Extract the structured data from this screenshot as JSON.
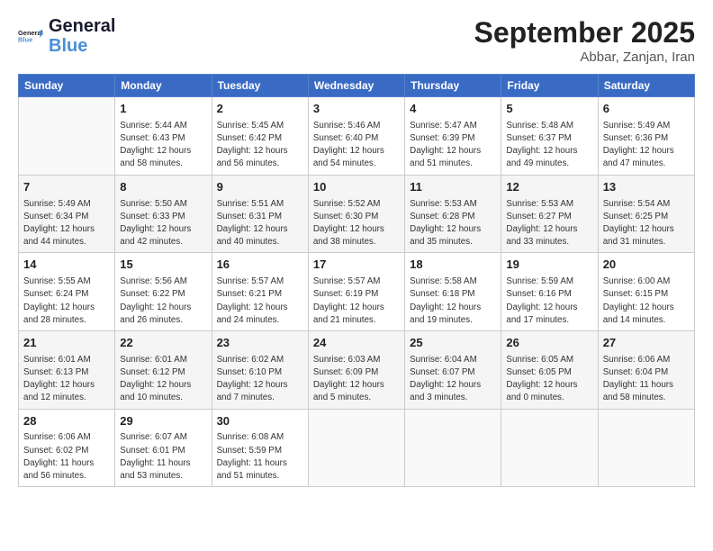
{
  "header": {
    "logo_line1": "General",
    "logo_line2": "Blue",
    "month": "September 2025",
    "location": "Abbar, Zanjan, Iran"
  },
  "weekdays": [
    "Sunday",
    "Monday",
    "Tuesday",
    "Wednesday",
    "Thursday",
    "Friday",
    "Saturday"
  ],
  "weeks": [
    [
      {
        "day": "",
        "info": ""
      },
      {
        "day": "1",
        "info": "Sunrise: 5:44 AM\nSunset: 6:43 PM\nDaylight: 12 hours\nand 58 minutes."
      },
      {
        "day": "2",
        "info": "Sunrise: 5:45 AM\nSunset: 6:42 PM\nDaylight: 12 hours\nand 56 minutes."
      },
      {
        "day": "3",
        "info": "Sunrise: 5:46 AM\nSunset: 6:40 PM\nDaylight: 12 hours\nand 54 minutes."
      },
      {
        "day": "4",
        "info": "Sunrise: 5:47 AM\nSunset: 6:39 PM\nDaylight: 12 hours\nand 51 minutes."
      },
      {
        "day": "5",
        "info": "Sunrise: 5:48 AM\nSunset: 6:37 PM\nDaylight: 12 hours\nand 49 minutes."
      },
      {
        "day": "6",
        "info": "Sunrise: 5:49 AM\nSunset: 6:36 PM\nDaylight: 12 hours\nand 47 minutes."
      }
    ],
    [
      {
        "day": "7",
        "info": "Sunrise: 5:49 AM\nSunset: 6:34 PM\nDaylight: 12 hours\nand 44 minutes."
      },
      {
        "day": "8",
        "info": "Sunrise: 5:50 AM\nSunset: 6:33 PM\nDaylight: 12 hours\nand 42 minutes."
      },
      {
        "day": "9",
        "info": "Sunrise: 5:51 AM\nSunset: 6:31 PM\nDaylight: 12 hours\nand 40 minutes."
      },
      {
        "day": "10",
        "info": "Sunrise: 5:52 AM\nSunset: 6:30 PM\nDaylight: 12 hours\nand 38 minutes."
      },
      {
        "day": "11",
        "info": "Sunrise: 5:53 AM\nSunset: 6:28 PM\nDaylight: 12 hours\nand 35 minutes."
      },
      {
        "day": "12",
        "info": "Sunrise: 5:53 AM\nSunset: 6:27 PM\nDaylight: 12 hours\nand 33 minutes."
      },
      {
        "day": "13",
        "info": "Sunrise: 5:54 AM\nSunset: 6:25 PM\nDaylight: 12 hours\nand 31 minutes."
      }
    ],
    [
      {
        "day": "14",
        "info": "Sunrise: 5:55 AM\nSunset: 6:24 PM\nDaylight: 12 hours\nand 28 minutes."
      },
      {
        "day": "15",
        "info": "Sunrise: 5:56 AM\nSunset: 6:22 PM\nDaylight: 12 hours\nand 26 minutes."
      },
      {
        "day": "16",
        "info": "Sunrise: 5:57 AM\nSunset: 6:21 PM\nDaylight: 12 hours\nand 24 minutes."
      },
      {
        "day": "17",
        "info": "Sunrise: 5:57 AM\nSunset: 6:19 PM\nDaylight: 12 hours\nand 21 minutes."
      },
      {
        "day": "18",
        "info": "Sunrise: 5:58 AM\nSunset: 6:18 PM\nDaylight: 12 hours\nand 19 minutes."
      },
      {
        "day": "19",
        "info": "Sunrise: 5:59 AM\nSunset: 6:16 PM\nDaylight: 12 hours\nand 17 minutes."
      },
      {
        "day": "20",
        "info": "Sunrise: 6:00 AM\nSunset: 6:15 PM\nDaylight: 12 hours\nand 14 minutes."
      }
    ],
    [
      {
        "day": "21",
        "info": "Sunrise: 6:01 AM\nSunset: 6:13 PM\nDaylight: 12 hours\nand 12 minutes."
      },
      {
        "day": "22",
        "info": "Sunrise: 6:01 AM\nSunset: 6:12 PM\nDaylight: 12 hours\nand 10 minutes."
      },
      {
        "day": "23",
        "info": "Sunrise: 6:02 AM\nSunset: 6:10 PM\nDaylight: 12 hours\nand 7 minutes."
      },
      {
        "day": "24",
        "info": "Sunrise: 6:03 AM\nSunset: 6:09 PM\nDaylight: 12 hours\nand 5 minutes."
      },
      {
        "day": "25",
        "info": "Sunrise: 6:04 AM\nSunset: 6:07 PM\nDaylight: 12 hours\nand 3 minutes."
      },
      {
        "day": "26",
        "info": "Sunrise: 6:05 AM\nSunset: 6:05 PM\nDaylight: 12 hours\nand 0 minutes."
      },
      {
        "day": "27",
        "info": "Sunrise: 6:06 AM\nSunset: 6:04 PM\nDaylight: 11 hours\nand 58 minutes."
      }
    ],
    [
      {
        "day": "28",
        "info": "Sunrise: 6:06 AM\nSunset: 6:02 PM\nDaylight: 11 hours\nand 56 minutes."
      },
      {
        "day": "29",
        "info": "Sunrise: 6:07 AM\nSunset: 6:01 PM\nDaylight: 11 hours\nand 53 minutes."
      },
      {
        "day": "30",
        "info": "Sunrise: 6:08 AM\nSunset: 5:59 PM\nDaylight: 11 hours\nand 51 minutes."
      },
      {
        "day": "",
        "info": ""
      },
      {
        "day": "",
        "info": ""
      },
      {
        "day": "",
        "info": ""
      },
      {
        "day": "",
        "info": ""
      }
    ]
  ]
}
